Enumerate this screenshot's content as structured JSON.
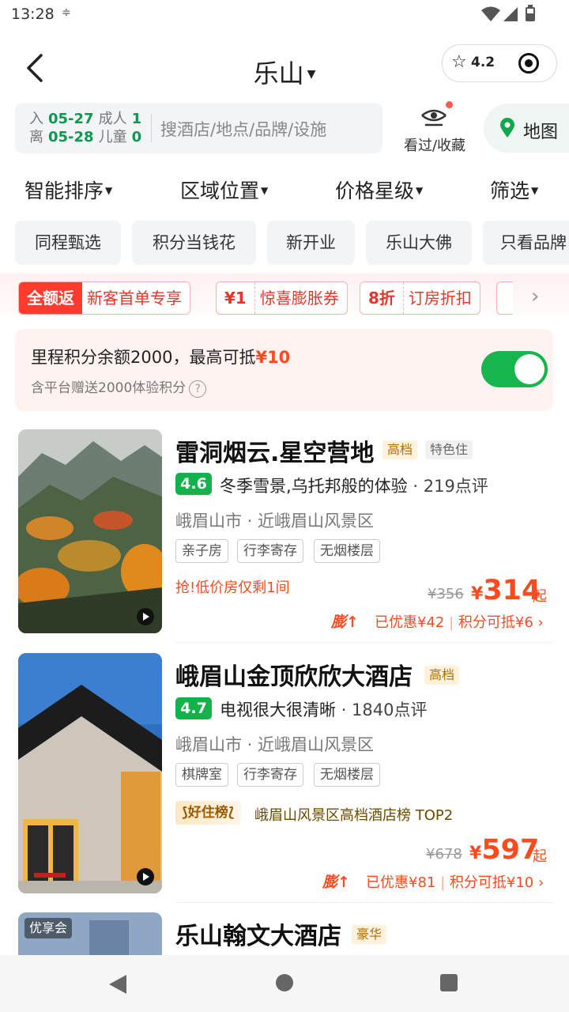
{
  "status_bar": {
    "time": "13:28"
  },
  "header": {
    "city": "乐山",
    "rating": "4.2"
  },
  "search": {
    "checkin_label": "入",
    "checkin_date": "05-27",
    "checkout_label": "离",
    "checkout_date": "05-28",
    "adults_label": "成人",
    "adults_count": "1",
    "children_label": "儿童",
    "children_count": "0",
    "placeholder": "搜酒店/地点/品牌/设施",
    "viewed_label": "看过/收藏",
    "map_label": "地图"
  },
  "sort": {
    "smart": "智能排序",
    "area": "区域位置",
    "price_star": "价格星级",
    "filter": "筛选"
  },
  "chips": [
    "同程甄选",
    "积分当钱花",
    "新开业",
    "乐山大佛",
    "只看品牌"
  ],
  "promos": [
    {
      "left": "全额返",
      "right": "新客首单专享"
    },
    {
      "left": "¥1",
      "right": "惊喜膨胀券"
    },
    {
      "left": "8折",
      "right": "订房折扣"
    }
  ],
  "mileage": {
    "text": "里程积分余额2000，最高可抵",
    "amount": "¥10",
    "sub": "含平台赠送2000体验积分",
    "enabled": true
  },
  "hotels": [
    {
      "name": "雷洞烟云.星空营地",
      "grades": [
        "高档",
        "特色住"
      ],
      "score": "4.6",
      "review": "冬季雪景,乌托邦般的体验",
      "review_count": "· 219点评",
      "location": "峨眉山市 · 近峨眉山风景区",
      "tags": [
        "亲子房",
        "行李寄存",
        "无烟楼层"
      ],
      "urgent": "抢!低价房仅剩1间",
      "old_price": "¥356",
      "currency": "¥",
      "price": "314",
      "price_suffix": "起",
      "swell": "膨",
      "discount": "已优惠¥42",
      "points": "积分可抵¥6"
    },
    {
      "name": "峨眉山金顶欣欣大酒店",
      "grades": [
        "高档"
      ],
      "score": "4.7",
      "review": "电视很大很清晰",
      "review_count": "· 1840点评",
      "location": "峨眉山市 · 近峨眉山风景区",
      "tags": [
        "棋牌室",
        "行李寄存",
        "无烟楼层"
      ],
      "rank_badge": "好住榜",
      "rank_text": "峨眉山风景区高档酒店榜 TOP2",
      "old_price": "¥678",
      "currency": "¥",
      "price": "597",
      "price_suffix": "起",
      "swell": "膨",
      "discount": "已优惠¥81",
      "points": "积分可抵¥10"
    },
    {
      "name": "乐山翰文大酒店",
      "grades": [
        "豪华"
      ],
      "vip": "优享会"
    }
  ]
}
